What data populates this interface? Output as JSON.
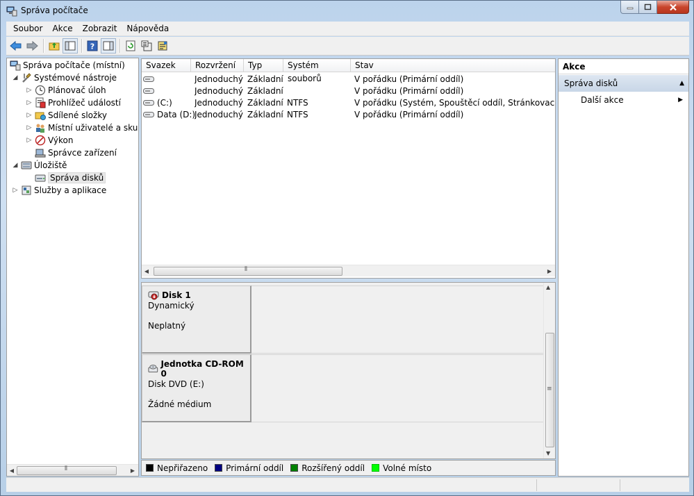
{
  "window": {
    "title": "Správa počítače"
  },
  "menu": [
    "Soubor",
    "Akce",
    "Zobrazit",
    "Nápověda"
  ],
  "toolbar": {
    "buttons": [
      "back-icon",
      "forward-icon",
      "up-folder-icon",
      "show-hide-tree-icon",
      "help-icon",
      "properties-panel-icon",
      "refresh-icon",
      "properties-icon",
      "disk-wizard-icon"
    ]
  },
  "tree": {
    "root": "Správa počítače (místní)",
    "system_tools": "Systémové nástroje",
    "task_scheduler": "Plánovač úloh",
    "event_viewer": "Prohlížeč událostí",
    "shared_folders": "Sdílené složky",
    "local_users": "Místní uživatelé a skupiny",
    "performance": "Výkon",
    "device_manager": "Správce zařízení",
    "storage": "Úložiště",
    "disk_management": "Správa disků",
    "services_apps": "Služby a aplikace"
  },
  "volumes": {
    "columns": [
      "Svazek",
      "Rozvržení",
      "Typ",
      "Systém souborů",
      "Stav"
    ],
    "rows": [
      {
        "volume": "",
        "layout": "Jednoduchý",
        "type": "Základní",
        "fs": "",
        "status": "V pořádku (Primární oddíl)"
      },
      {
        "volume": "",
        "layout": "Jednoduchý",
        "type": "Základní",
        "fs": "",
        "status": "V pořádku (Primární oddíl)"
      },
      {
        "volume": "(C:)",
        "layout": "Jednoduchý",
        "type": "Základní",
        "fs": "NTFS",
        "status": "V pořádku (Systém, Spouštěcí oddíl, Stránkovací soubor"
      },
      {
        "volume": "Data (D:)",
        "layout": "Jednoduchý",
        "type": "Základní",
        "fs": "NTFS",
        "status": "V pořádku (Primární oddíl)"
      }
    ]
  },
  "disks": [
    {
      "name": "Disk 1",
      "type": "Dynamický",
      "state": "Neplatný"
    },
    {
      "name": "Jednotka CD-ROM 0",
      "type": "Disk DVD (E:)",
      "state": "Žádné médium"
    }
  ],
  "legend": [
    {
      "label": "Nepřiřazeno",
      "color": "#000000"
    },
    {
      "label": "Primární oddíl",
      "color": "#000080"
    },
    {
      "label": "Rozšířený oddíl",
      "color": "#008000"
    },
    {
      "label": "Volné místo",
      "color": "#00ff00"
    }
  ],
  "actions": {
    "header": "Akce",
    "section": "Správa disků",
    "more": "Další akce"
  },
  "colors": {
    "titlebar": "#bcd3ec",
    "selection": "#c8d6e7"
  }
}
